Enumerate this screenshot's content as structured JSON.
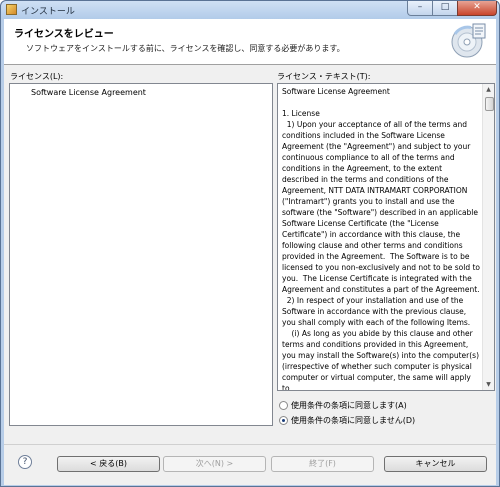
{
  "window": {
    "title": "インストール",
    "min_glyph": "–",
    "max_glyph": "□",
    "close_glyph": "✕"
  },
  "header": {
    "title": "ライセンスをレビュー",
    "description": "ソフトウェアをインストールする前に、ライセンスを確認し、同意する必要があります。"
  },
  "licenses_panel": {
    "label": "ライセンス(L):",
    "items": [
      "Software License Agreement"
    ]
  },
  "license_text_panel": {
    "label": "ライセンス・テキスト(T):",
    "text": "Software License Agreement\n\n1. License\n  1) Upon your acceptance of all of the terms and conditions included in the Software License Agreement (the \"Agreement\") and subject to your continuous compliance to all of the terms and conditions in the Agreement, to the extent described in the terms and conditions of the Agreement, NTT DATA INTRAMART CORPORATION (\"Intramart\") grants you to install and use the software (the \"Software\") described in an applicable Software License Certificate (the \"License Certificate\") in accordance with this clause, the following clause and other terms and conditions provided in the Agreement.  The Software is to be licensed to you non-exclusively and not to be sold to you.  The License Certificate is integrated with the Agreement and constitutes a part of the Agreement.\n  2) In respect of your installation and use of the Software in accordance with the previous clause, you shall comply with each of the following Items.\n    (i) As long as you abide by this clause and other terms and conditions provided in this Agreement,  you may install the Software(s) into the computer(s) (irrespective of whether such computer is physical computer or virtual computer, the same will apply to"
  },
  "agreement": {
    "accept_label": "使用条件の条項に同意します(A)",
    "decline_label": "使用条件の条項に同意しません(D)",
    "selected": "decline"
  },
  "footer": {
    "help_glyph": "?",
    "back_label": "< 戻る(B)",
    "next_label": "次へ(N) >",
    "finish_label": "終了(F)",
    "cancel_label": "キャンセル"
  }
}
